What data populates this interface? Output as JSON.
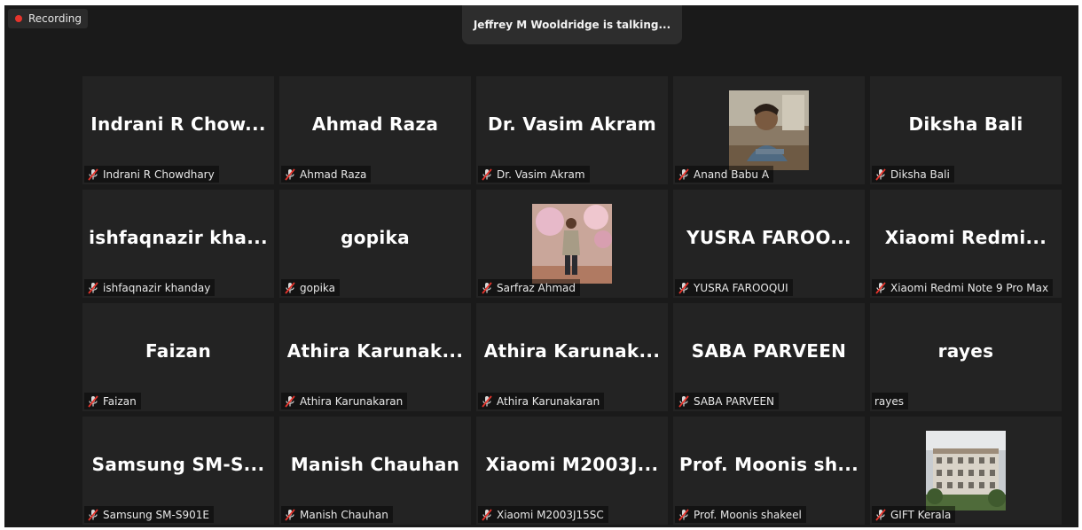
{
  "recording": {
    "label": "Recording",
    "color": "#e5342c"
  },
  "banner": {
    "text": "Jeffrey M Wooldridge is talking..."
  },
  "participants": [
    {
      "display": "Indrani R Chow...",
      "name": "Indrani R Chowdhary",
      "muted": true,
      "video": false
    },
    {
      "display": "Ahmad Raza",
      "name": "Ahmad Raza",
      "muted": true,
      "video": false
    },
    {
      "display": "Dr. Vasim Akram",
      "name": "Dr. Vasim Akram",
      "muted": true,
      "video": false
    },
    {
      "display": "",
      "name": "Anand Babu A",
      "muted": true,
      "video": true
    },
    {
      "display": "Diksha Bali",
      "name": "Diksha Bali",
      "muted": true,
      "video": false
    },
    {
      "display": "ishfaqnazir kha...",
      "name": "ishfaqnazir khanday",
      "muted": true,
      "video": false
    },
    {
      "display": "gopika",
      "name": "gopika",
      "muted": true,
      "video": false
    },
    {
      "display": "",
      "name": "Sarfraz Ahmad",
      "muted": true,
      "video": true
    },
    {
      "display": "YUSRA FAROO...",
      "name": "YUSRA FAROOQUI",
      "muted": true,
      "video": false
    },
    {
      "display": "Xiaomi Redmi...",
      "name": "Xiaomi Redmi Note 9 Pro Max",
      "muted": true,
      "video": false
    },
    {
      "display": "Faizan",
      "name": "Faizan",
      "muted": true,
      "video": false
    },
    {
      "display": "Athira Karunak...",
      "name": "Athira Karunakaran",
      "muted": true,
      "video": false
    },
    {
      "display": "Athira Karunak...",
      "name": "Athira Karunakaran",
      "muted": true,
      "video": false
    },
    {
      "display": "SABA PARVEEN",
      "name": "SABA PARVEEN",
      "muted": true,
      "video": false
    },
    {
      "display": "rayes",
      "name": "rayes",
      "muted": false,
      "video": false
    },
    {
      "display": "Samsung SM-S...",
      "name": "Samsung SM-S901E",
      "muted": true,
      "video": false
    },
    {
      "display": "Manish Chauhan",
      "name": "Manish Chauhan",
      "muted": true,
      "video": false
    },
    {
      "display": "Xiaomi M2003J...",
      "name": "Xiaomi M2003J15SC",
      "muted": true,
      "video": false
    },
    {
      "display": "Prof. Moonis sh...",
      "name": "Prof. Moonis shakeel",
      "muted": true,
      "video": false
    },
    {
      "display": "",
      "name": "GIFT Kerala",
      "muted": true,
      "video": true
    }
  ]
}
